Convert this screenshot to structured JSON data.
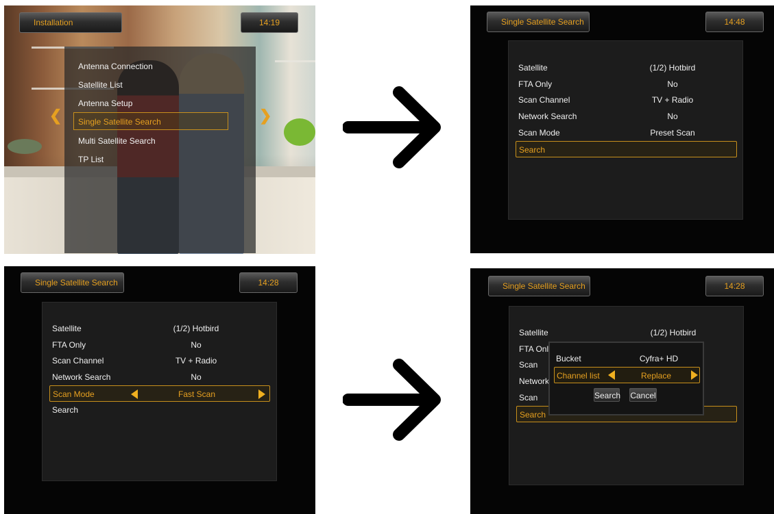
{
  "screen1": {
    "title": "Installation",
    "time": "14:19",
    "menu": [
      {
        "label": "Antenna Connection"
      },
      {
        "label": "Satellite List"
      },
      {
        "label": "Antenna Setup"
      },
      {
        "label": "Single Satellite Search"
      },
      {
        "label": "Multi Satellite Search"
      },
      {
        "label": "TP List"
      }
    ],
    "selected_index": 3
  },
  "screen2": {
    "title": "Single Satellite Search",
    "time": "14:48",
    "rows": [
      {
        "label": "Satellite",
        "value": "(1/2) Hotbird"
      },
      {
        "label": "FTA Only",
        "value": "No"
      },
      {
        "label": "Scan Channel",
        "value": "TV + Radio"
      },
      {
        "label": "Network Search",
        "value": "No"
      },
      {
        "label": "Scan Mode",
        "value": "Preset Scan"
      },
      {
        "label": "Search",
        "value": ""
      }
    ],
    "selected_row": "Search"
  },
  "screen3": {
    "title": "Single Satellite Search",
    "time": "14:28",
    "rows": [
      {
        "label": "Satellite",
        "value": "(1/2) Hotbird"
      },
      {
        "label": "FTA Only",
        "value": "No"
      },
      {
        "label": "Scan Channel",
        "value": "TV + Radio"
      },
      {
        "label": "Network Search",
        "value": "No"
      },
      {
        "label": "Scan Mode",
        "value": "Fast Scan"
      },
      {
        "label": "Search",
        "value": ""
      }
    ],
    "selected_row": "Scan Mode"
  },
  "screen4": {
    "title": "Single Satellite Search",
    "time": "14:28",
    "rows": [
      {
        "label": "Satellite",
        "value": "(1/2) Hotbird"
      },
      {
        "label": "FTA Only",
        "value": ""
      },
      {
        "label": "Scan Cha",
        "value": ""
      },
      {
        "label": "Network",
        "value": ""
      },
      {
        "label": "Scan Mo",
        "value": ""
      },
      {
        "label": "Search",
        "value": ""
      }
    ],
    "dialog": {
      "bucket_label": "Bucket",
      "bucket_value": "Cyfra+ HD",
      "channel_list_label": "Channel list",
      "channel_list_value": "Replace",
      "search_button": "Search",
      "cancel_button": "Cancel"
    }
  },
  "icons": [
    "right-arrow-icon",
    "left-triangle-icon",
    "right-triangle-icon"
  ],
  "colors": {
    "accent": "#e6a020",
    "panel": "#1c1c1c",
    "background": "#050505"
  }
}
